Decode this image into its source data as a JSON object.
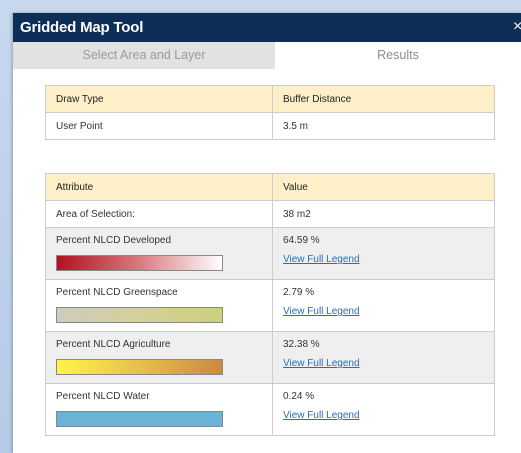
{
  "window": {
    "title": "Gridded Map Tool",
    "close_glyph": "×"
  },
  "tabs": [
    {
      "label": "Select Area and Layer",
      "active": false
    },
    {
      "label": "Results",
      "active": true
    }
  ],
  "draw_table": {
    "headers": [
      "Draw Type",
      "Buffer Distance"
    ],
    "rows": [
      [
        "User Point",
        "3.5 m"
      ]
    ]
  },
  "attribute_table": {
    "headers": [
      "Attribute",
      "Value"
    ],
    "area": {
      "label": "Area of Selection:",
      "value": "38 m2"
    },
    "rows": [
      {
        "label": "Percent NLCD Developed",
        "value": "64.59 %",
        "link": "View Full Legend",
        "gradient": [
          "#b0121f",
          "#d87a80",
          "#ffffff"
        ]
      },
      {
        "label": "Percent NLCD Greenspace",
        "value": "2.79 %",
        "link": "View Full Legend",
        "gradient": [
          "#cfcbbf",
          "#d4d09a",
          "#cbd07e"
        ]
      },
      {
        "label": "Percent NLCD Agriculture",
        "value": "32.38 %",
        "link": "View Full Legend",
        "gradient": [
          "#fff44a",
          "#e6c04a",
          "#c88a42"
        ]
      },
      {
        "label": "Percent NLCD Water",
        "value": "0.24 %",
        "link": "View Full Legend",
        "gradient": [
          "#6bb3d6",
          "#6bb3d6",
          "#6bb3d6"
        ]
      }
    ]
  },
  "colors": {
    "titlebar": "#0d2f57",
    "header_row": "#fdf0c8",
    "link": "#2a6db5"
  }
}
